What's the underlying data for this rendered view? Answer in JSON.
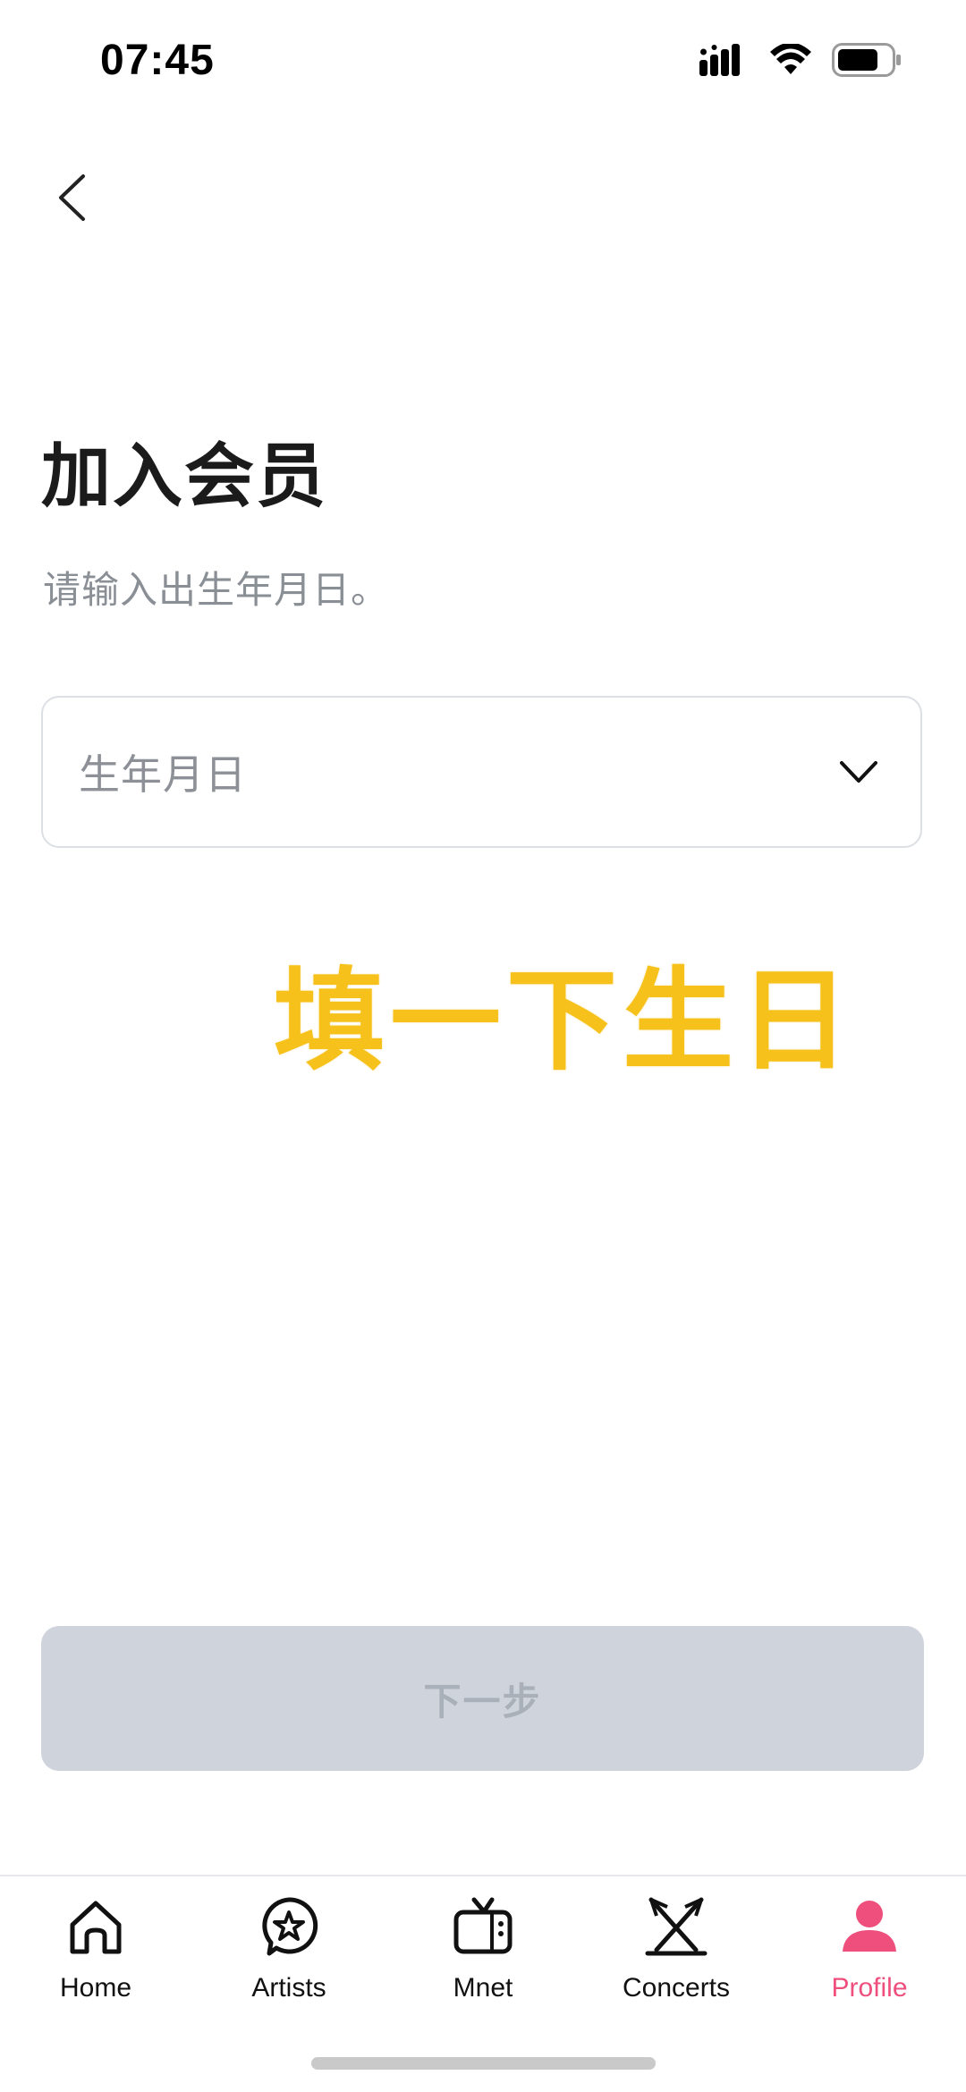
{
  "status_bar": {
    "time": "07:45"
  },
  "header": {
    "back_icon": "chevron-left-icon"
  },
  "page": {
    "title": "加入会员",
    "subtitle": "请输入出生年月日。"
  },
  "birth_field": {
    "placeholder": "生年月日",
    "icon": "chevron-down-icon"
  },
  "annotation": {
    "text": "填一下生日",
    "color": "#f6c11b"
  },
  "next_button": {
    "label": "下一步",
    "enabled": false
  },
  "bottom_nav": {
    "items": [
      {
        "label": "Home",
        "icon": "home-icon",
        "active": false
      },
      {
        "label": "Artists",
        "icon": "artist-star-icon",
        "active": false
      },
      {
        "label": "Mnet",
        "icon": "tv-icon",
        "active": false
      },
      {
        "label": "Concerts",
        "icon": "concert-lights-icon",
        "active": false
      },
      {
        "label": "Profile",
        "icon": "profile-icon",
        "active": true
      }
    ],
    "active_color": "#ef4f7d"
  }
}
